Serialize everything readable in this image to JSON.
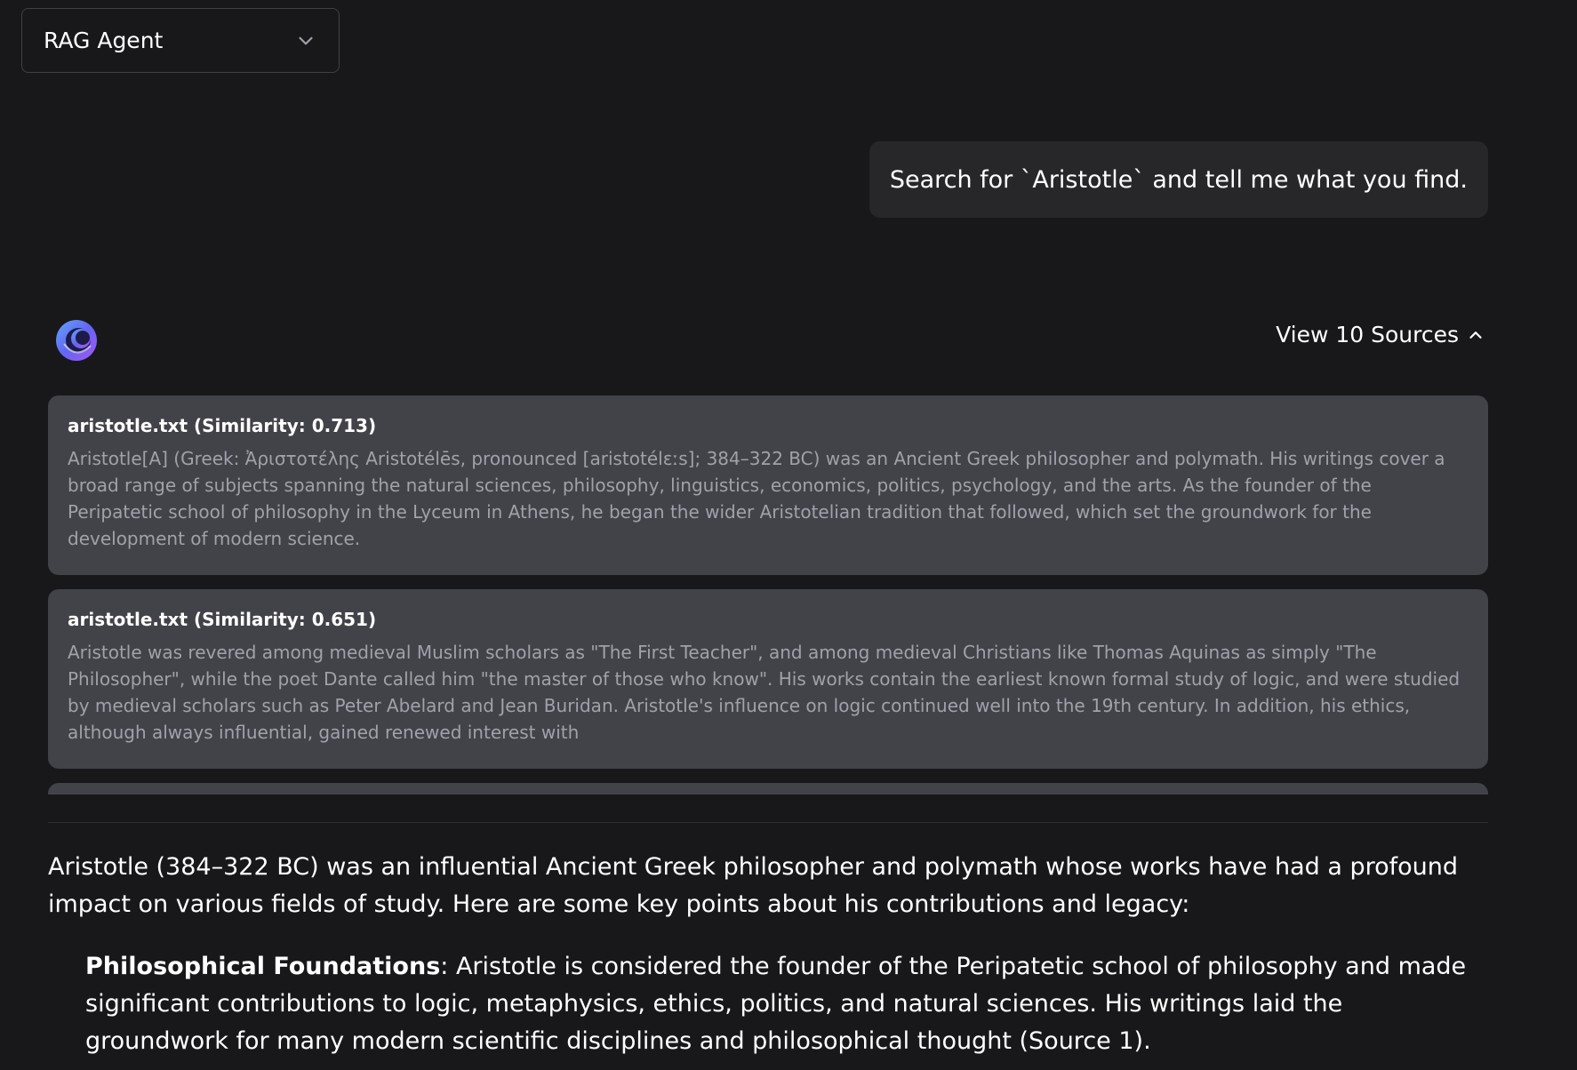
{
  "agent_selector": {
    "label": "RAG Agent",
    "icon": "chevron-down-icon"
  },
  "user_message": {
    "text": "Search for `Aristotle` and tell me what you find."
  },
  "assistant": {
    "avatar_icon": "assistant-logo-icon",
    "view_sources_label": "View 10 Sources",
    "sources": [
      {
        "title": "aristotle.txt (Similarity: 0.713)",
        "text": "Aristotle[A] (Greek: Ἀριστοτέλης Aristotélēs, pronounced [aristotélɛːs]; 384–322 BC) was an Ancient Greek philosopher and polymath. His writings cover a broad range of subjects spanning the natural sciences, philosophy, linguistics, economics, politics, psychology, and the arts. As the founder of the Peripatetic school of philosophy in the Lyceum in Athens, he began the wider Aristotelian tradition that followed, which set the groundwork for the development of modern science."
      },
      {
        "title": "aristotle.txt (Similarity: 0.651)",
        "text": "Aristotle was revered among medieval Muslim scholars as \"The First Teacher\", and among medieval Christians like Thomas Aquinas as simply \"The Philosopher\", while the poet Dante called him \"the master of those who know\". His works contain the earliest known formal study of logic, and were studied by medieval scholars such as Peter Abelard and Jean Buridan. Aristotle's influence on logic continued well into the 19th century. In addition, his ethics, although always influential, gained renewed interest with"
      }
    ],
    "answer_intro": "Aristotle (384–322 BC) was an influential Ancient Greek philosopher and polymath whose works have had a profound impact on various fields of study. Here are some key points about his contributions and legacy:",
    "points": [
      {
        "heading": "Philosophical Foundations",
        "text": ": Aristotle is considered the founder of the Peripatetic school of philosophy and made significant contributions to logic, metaphysics, ethics, politics, and natural sciences. His writings laid the groundwork for many modern scientific disciplines and philosophical thought (Source 1)."
      }
    ]
  },
  "colors": {
    "background": "#18181b",
    "bubble": "#27272a",
    "source_card": "#424249",
    "muted_text": "#a1a1aa"
  }
}
